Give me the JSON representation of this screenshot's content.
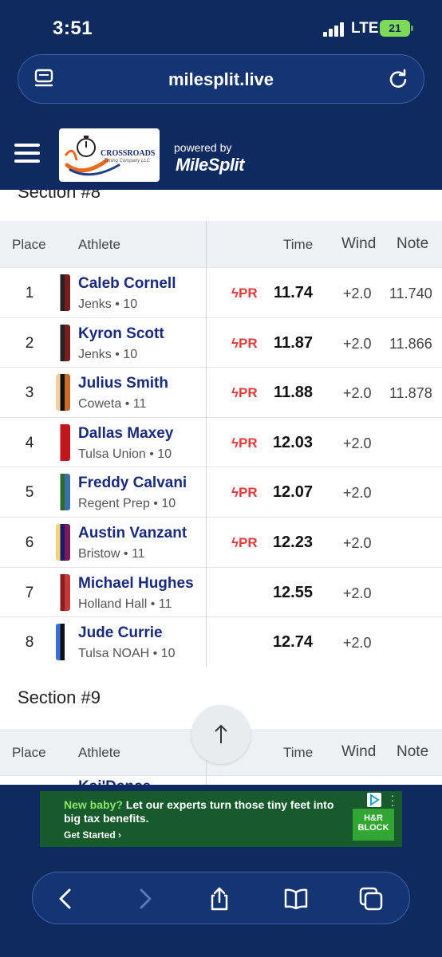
{
  "status_bar": {
    "time": "3:51",
    "network": "LTE",
    "battery": "21"
  },
  "url_bar": {
    "domain": "milesplit.live"
  },
  "site_header": {
    "logo_text": "CROSSROADS",
    "logo_subtext": "Timing Company LLC",
    "powered_by": "powered by",
    "brand": "MileSplit"
  },
  "colors": {
    "navy": "#0f2a5e",
    "link": "#1a2a7c",
    "pr_red": "#e23b3b",
    "ad_green": "#175b2d"
  },
  "results": {
    "partial_section_title": "Section #8",
    "columns": {
      "place": "Place",
      "athlete": "Athlete",
      "time": "Time",
      "wind": "Wind",
      "note": "Note"
    },
    "rows": [
      {
        "place": "1",
        "name": "Caleb Cornell",
        "meta": "Jenks • 10",
        "pr": "PR",
        "time": "11.74",
        "wind": "+2.0",
        "note": "11.740"
      },
      {
        "place": "2",
        "name": "Kyron Scott",
        "meta": "Jenks • 10",
        "pr": "PR",
        "time": "11.87",
        "wind": "+2.0",
        "note": "11.866"
      },
      {
        "place": "3",
        "name": "Julius Smith",
        "meta": "Coweta • 11",
        "pr": "PR",
        "time": "11.88",
        "wind": "+2.0",
        "note": "11.878"
      },
      {
        "place": "4",
        "name": "Dallas Maxey",
        "meta": "Tulsa Union • 10",
        "pr": "PR",
        "time": "12.03",
        "wind": "+2.0",
        "note": ""
      },
      {
        "place": "5",
        "name": "Freddy Calvani",
        "meta": "Regent Prep • 10",
        "pr": "PR",
        "time": "12.07",
        "wind": "+2.0",
        "note": ""
      },
      {
        "place": "6",
        "name": "Austin Vanzant",
        "meta": "Bristow • 11",
        "pr": "PR",
        "time": "12.23",
        "wind": "+2.0",
        "note": ""
      },
      {
        "place": "7",
        "name": "Michael Hughes",
        "meta": "Holland Hall • 11",
        "pr": "",
        "time": "12.55",
        "wind": "+2.0",
        "note": ""
      },
      {
        "place": "8",
        "name": "Jude Currie",
        "meta": "Tulsa NOAH • 10",
        "pr": "",
        "time": "12.74",
        "wind": "+2.0",
        "note": ""
      }
    ],
    "next_section_title": "Section #9",
    "next_first_athlete": "Kai'Dence"
  },
  "ad": {
    "headline_highlight": "New baby?",
    "headline_rest": " Let our experts turn those tiny feet into big tax benefits.",
    "cta": "Get Started",
    "brand_line1": "H&R",
    "brand_line2": "BLOCK"
  }
}
